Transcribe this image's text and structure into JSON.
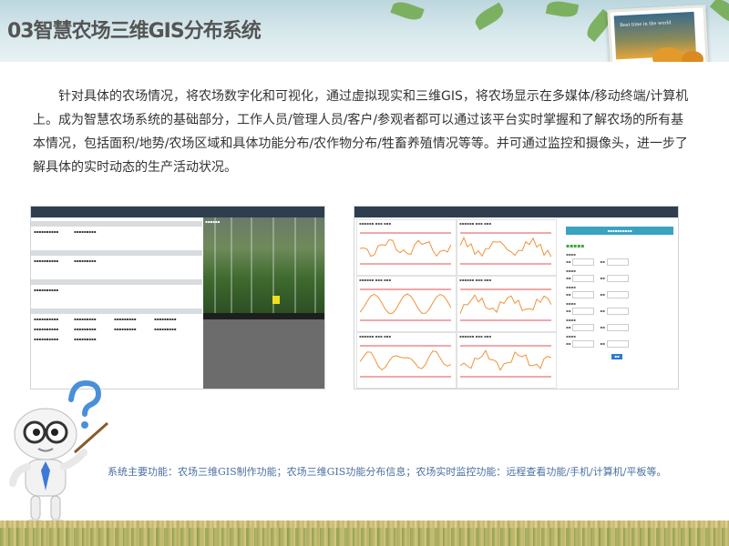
{
  "title": "03智慧农场三维GIS分布系统",
  "paragraph": "针对具体的农场情况，将农场数字化和可视化，通过虚拟现实和三维GIS，将农场显示在多媒体/移动终端/计算机上。成为智慧农场系统的基础部分，工作人员/管理人员/客户/参观者都可以通过该平台实时掌握和了解农场的所有基本情况，包括面积/地势/农场区域和具体功能分布/农作物分布/牲畜养殖情况等等。并可通过监控和摄像头，进一步了解具体的实时动态的生产活动状况。",
  "caption": "系统主要功能：农场三维GIS制作功能；农场三维GIS功能分布信息；农场实时监控功能：远程查看功能/手机/计算机/平板等。",
  "book_text": "Best time in the world",
  "colors": {
    "title": "#555555",
    "caption": "#4a6fa2",
    "nav": "#2e3e4e",
    "accent": "#3aa3c2",
    "green": "#3aa63a"
  },
  "icons": [
    "question-mark-icon",
    "pointer-stick-icon"
  ]
}
